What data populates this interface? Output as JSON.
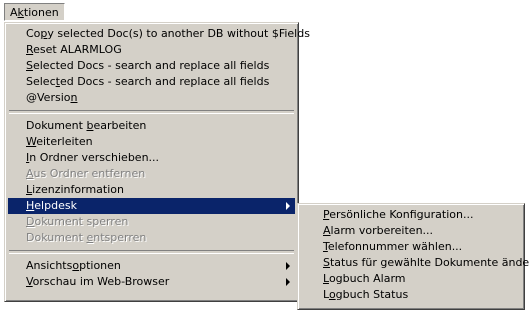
{
  "menubar": {
    "item": {
      "pre": "A",
      "key": "k",
      "post": "tionen"
    }
  },
  "main_menu": {
    "items": [
      {
        "pre": "Co",
        "key": "p",
        "post": "y selected Doc(s) to another DB without $Fields"
      },
      {
        "pre": "",
        "key": "R",
        "post": "eset ALARMLOG"
      },
      {
        "pre": "",
        "key": "S",
        "post": "elected Docs - search and replace all fields"
      },
      {
        "pre": "Selec",
        "key": "t",
        "post": "ed Docs - search and replace all fields"
      },
      {
        "pre": "@Versio",
        "key": "n",
        "post": ""
      },
      {
        "pre": "Dokument ",
        "key": "b",
        "post": "earbeiten"
      },
      {
        "pre": "",
        "key": "W",
        "post": "eiterleiten"
      },
      {
        "pre": "",
        "key": "I",
        "post": "n Ordner verschieben..."
      },
      {
        "pre": "",
        "key": "A",
        "post": "us Ordner entfernen"
      },
      {
        "pre": "",
        "key": "L",
        "post": "izenzinformation"
      },
      {
        "pre": "",
        "key": "H",
        "post": "elpdesk"
      },
      {
        "pre": "",
        "key": "D",
        "post": "okument sperren"
      },
      {
        "pre": "Dokument ",
        "key": "e",
        "post": "ntsperren"
      },
      {
        "pre": "Ansichts",
        "key": "o",
        "post": "ptionen"
      },
      {
        "pre": "",
        "key": "V",
        "post": "orschau im Web-Browser"
      }
    ]
  },
  "sub_menu": {
    "items": [
      {
        "pre": "",
        "key": "P",
        "post": "ersönliche Konfiguration..."
      },
      {
        "pre": "",
        "key": "A",
        "post": "larm vorbereiten..."
      },
      {
        "pre": "",
        "key": "T",
        "post": "elefonnummer wählen..."
      },
      {
        "pre": "",
        "key": "S",
        "post": "tatus für gewählte Dokumente ändern..."
      },
      {
        "pre": "",
        "key": "L",
        "post": "ogbuch Alarm"
      },
      {
        "pre": "L",
        "key": "o",
        "post": "gbuch Status"
      }
    ]
  },
  "colors": {
    "menu_bg": "#d4d0c8",
    "highlight_bg": "#0a246a",
    "highlight_text": "#ffffff",
    "disabled_text": "#808080"
  }
}
